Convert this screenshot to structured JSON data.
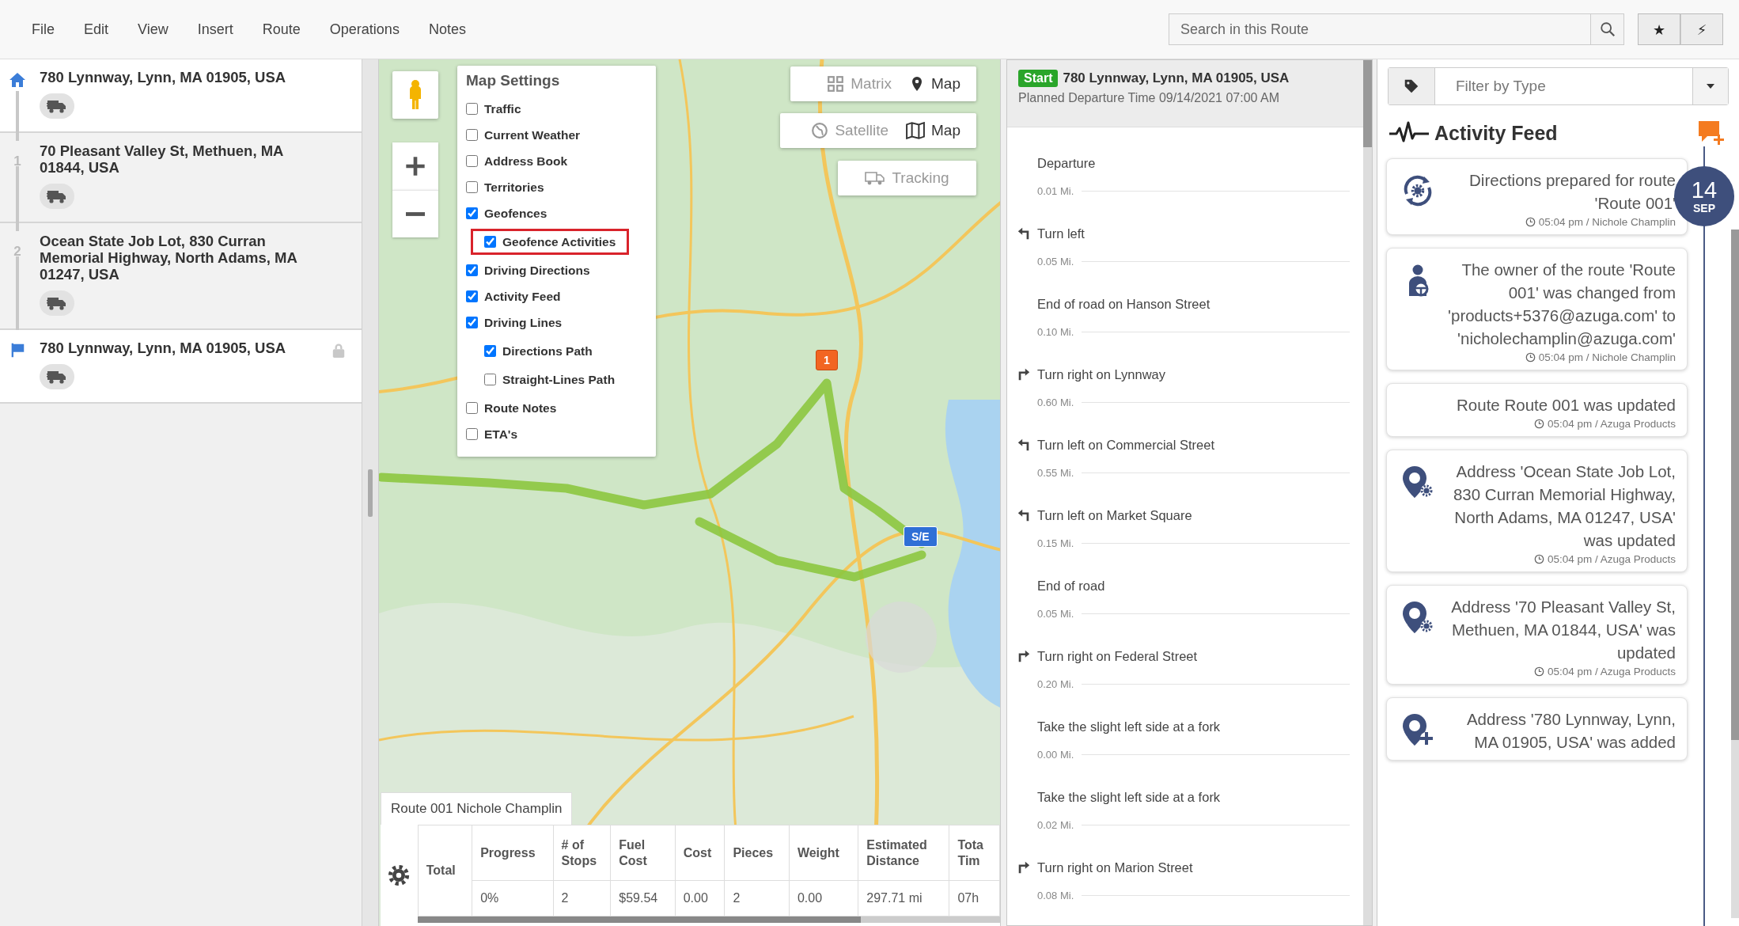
{
  "menu": [
    "File",
    "Edit",
    "View",
    "Insert",
    "Route",
    "Operations",
    "Notes"
  ],
  "search": {
    "placeholder": "Search in this Route"
  },
  "toolbar_buttons": [
    "★",
    "⚡"
  ],
  "stops": [
    {
      "kind": "start",
      "address": "780 Lynnway, Lynn, MA 01905, USA",
      "locked": false
    },
    {
      "kind": "stop",
      "number": "1",
      "address": "70 Pleasant Valley St, Methuen, MA 01844, USA",
      "locked": false
    },
    {
      "kind": "stop",
      "number": "2",
      "address": "Ocean State Job Lot, 830 Curran Memorial Highway, North Adams, MA 01247, USA",
      "locked": false
    },
    {
      "kind": "end",
      "address": "780 Lynnway, Lynn, MA 01905, USA",
      "locked": true
    }
  ],
  "map": {
    "settings": {
      "title": "Map Settings",
      "options": [
        {
          "label": "Traffic",
          "checked": false
        },
        {
          "label": "Current Weather",
          "checked": false
        },
        {
          "label": "Address Book",
          "checked": false
        },
        {
          "label": "Territories",
          "checked": false
        },
        {
          "label": "Geofences",
          "checked": true,
          "children": [
            {
              "label": "Geofence Activities",
              "checked": true,
              "highlighted": true
            }
          ]
        },
        {
          "label": "Driving Directions",
          "checked": true
        },
        {
          "label": "Activity Feed",
          "checked": true
        },
        {
          "label": "Driving Lines",
          "checked": true,
          "children": [
            {
              "label": "Directions Path",
              "checked": true,
              "highlighted": false
            },
            {
              "label": "Straight-Lines Path",
              "checked": false,
              "highlighted": false
            }
          ]
        },
        {
          "label": "Route Notes",
          "checked": false
        },
        {
          "label": "ETA's",
          "checked": false
        }
      ]
    },
    "view_toggle": [
      {
        "kind": "matrix",
        "label": "Matrix",
        "selected": false
      },
      {
        "kind": "map",
        "label": "Map",
        "selected": true
      }
    ],
    "layer_toggle": [
      {
        "kind": "satellite",
        "label": "Satellite",
        "selected": false
      },
      {
        "kind": "map",
        "label": "Map",
        "selected": true
      }
    ],
    "tracking": {
      "label": "Tracking",
      "disabled": true
    },
    "markers": [
      {
        "kind": "stop",
        "label": "1"
      },
      {
        "kind": "start_end",
        "label": "S/E"
      }
    ],
    "route_tab": "Route 001 Nichole Champlin",
    "summary": {
      "row_header": "Total",
      "columns": [
        "Progress",
        "# of Stops",
        "Fuel Cost",
        "Cost",
        "Pieces",
        "Weight",
        "Estimated Distance",
        "Tota Tim"
      ],
      "values": [
        "0%",
        "2",
        "$59.54",
        "0.00",
        "2",
        "0.00",
        "297.71 mi",
        "07h"
      ]
    }
  },
  "directions": {
    "badge": "Start",
    "address": "780 Lynnway, Lynn, MA 01905, USA",
    "planned": "Planned Departure Time 09/14/2021 07:00 AM",
    "steps": [
      {
        "kind": "plain",
        "text": "Departure",
        "distance": "0.01 Mi."
      },
      {
        "kind": "left",
        "text": "Turn left",
        "distance": "0.05 Mi."
      },
      {
        "kind": "plain",
        "text": "End of road on Hanson Street",
        "distance": "0.10 Mi."
      },
      {
        "kind": "right",
        "text": "Turn right on Lynnway",
        "distance": "0.60 Mi."
      },
      {
        "kind": "left",
        "text": "Turn left on Commercial Street",
        "distance": "0.55 Mi."
      },
      {
        "kind": "left",
        "text": "Turn left on Market Square",
        "distance": "0.15 Mi."
      },
      {
        "kind": "plain",
        "text": "End of road",
        "distance": "0.05 Mi."
      },
      {
        "kind": "right",
        "text": "Turn right on Federal Street",
        "distance": "0.20 Mi."
      },
      {
        "kind": "plain",
        "text": "Take the slight left side at a fork",
        "distance": "0.00 Mi."
      },
      {
        "kind": "plain",
        "text": "Take the slight left side at a fork",
        "distance": "0.02 Mi."
      },
      {
        "kind": "right",
        "text": "Turn right on Marion Street",
        "distance": "0.08 Mi."
      }
    ]
  },
  "activity": {
    "filter_placeholder": "Filter by Type",
    "title": "Activity Feed",
    "date": {
      "day": "14",
      "month": "SEP"
    },
    "items": [
      {
        "kind": "directions",
        "text": "Directions prepared for route 'Route 001'",
        "time": "05:04 pm / Nichole Champlin"
      },
      {
        "kind": "owner",
        "text": "The owner of the route 'Route 001' was changed from 'products+5376@azuga.com' to 'nicholechamplin@azuga.com'",
        "time": "05:04 pm / Nichole Champlin"
      },
      {
        "kind": "route_update",
        "text": "Route Route 001 was updated",
        "time": "05:04 pm / Azuga Products"
      },
      {
        "kind": "address_update",
        "text": "Address 'Ocean State Job Lot, 830 Curran Memorial Highway, North Adams, MA 01247, USA' was updated",
        "time": "05:04 pm / Azuga Products"
      },
      {
        "kind": "address_update",
        "text": "Address '70 Pleasant Valley St, Methuen, MA 01844, USA' was updated",
        "time": "05:04 pm / Azuga Products"
      },
      {
        "kind": "address_add",
        "text": "Address '780 Lynnway, Lynn, MA 01905, USA' was added"
      }
    ]
  }
}
